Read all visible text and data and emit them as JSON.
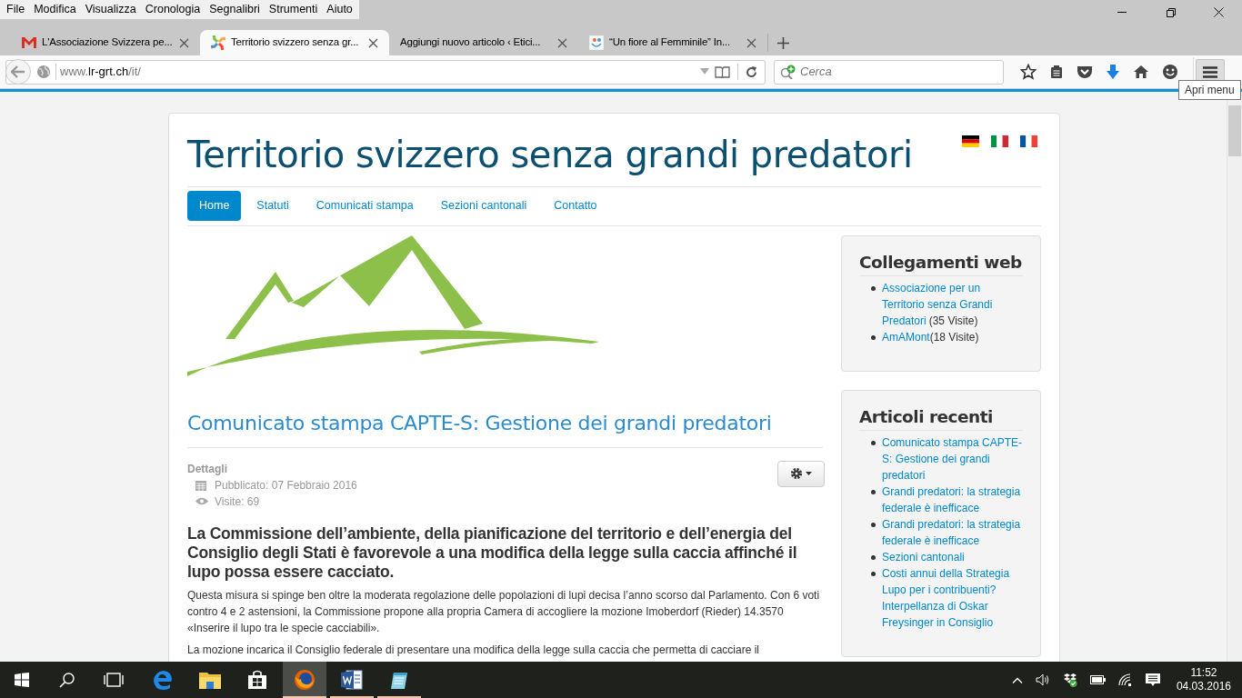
{
  "menu_bar": {
    "items": [
      "File",
      "Modifica",
      "Visualizza",
      "Cronologia",
      "Segnalibri",
      "Strumenti",
      "Aiuto"
    ]
  },
  "tabs": [
    {
      "title": "L'Associazione Svizzera pe...",
      "kind": "letter",
      "selected": false
    },
    {
      "title": "Territorio svizzero senza gr...",
      "kind": "pinwheel",
      "selected": true
    },
    {
      "title": "Aggiungi nuovo articolo ‹ Etici...",
      "kind": "plain",
      "selected": false
    },
    {
      "title": "“Un fiore al Femminile” In...",
      "kind": "tile",
      "selected": false
    }
  ],
  "address_bar": {
    "prefix": "www.",
    "host": "lr-grt.ch",
    "path": "/it/"
  },
  "search": {
    "placeholder": "Cerca"
  },
  "tooltip": "Apri menu",
  "site": {
    "title": "Territorio svizzero senza grandi predatori",
    "nav": [
      {
        "label": "Home",
        "selected": true
      },
      {
        "label": "Statuti",
        "selected": false
      },
      {
        "label": "Comunicati stampa",
        "selected": false
      },
      {
        "label": "Sezioni cantonali",
        "selected": false
      },
      {
        "label": "Contatto",
        "selected": false
      }
    ]
  },
  "article": {
    "title": "Comunicato stampa CAPTE-S: Gestione dei grandi predatori",
    "details_label": "Dettagli",
    "published": "Pubblicato: 07 Febbraio 2016",
    "visits": "Visite: 69",
    "lead": "La Commissione dell’ambiente, della pianificazione del territorio e dell’energia del Consiglio degli Stati è favorevole a una modifica della legge sulla caccia affinché il lupo possa essere cacciato.",
    "paragraphs": [
      "Questa misura si spinge ben oltre la moderata regolazione delle popolazioni di lupi decisa l’anno scorso dal Parlamento. Con 6 voti contro 4 e 2 astensioni, la Commissione propone alla propria Camera di accogliere la mozione Imoberdorf (Rieder) 14.3570 «Inserire il lupo tra le specie cacciabili».",
      "La mozione incarica il Consiglio federale di presentare una modifica della legge sulla caccia che permetta di cacciare il"
    ]
  },
  "sidebar": {
    "panels": [
      {
        "title": "Collegamenti web",
        "items": [
          {
            "link": "Associazione per un Territorio senza Grandi Predatori",
            "count": "(35 Visite)",
            "gap_before": true
          },
          {
            "link": "AmAMont",
            "count": "(18 Visite)",
            "gap_before": false
          }
        ]
      },
      {
        "title": "Articoli recenti",
        "items": [
          {
            "link": "Comunicato stampa CAPTE-S: Gestione dei grandi predatori"
          },
          {
            "link": "Grandi predatori: la strategia federale è inefficace"
          },
          {
            "link": "Grandi predatori: la strategia federale è inefficace"
          },
          {
            "link": "Sezioni cantonali"
          },
          {
            "link": "Costi annui della Strategia Lupo per i contribuenti? Interpellanza di Oskar Freysinger in Consiglio"
          }
        ]
      }
    ]
  },
  "taskbar": {
    "apps": [
      {
        "kind": "edge",
        "running": false,
        "selected": false
      },
      {
        "kind": "folder",
        "running": false,
        "selected": false
      },
      {
        "kind": "store",
        "running": false,
        "selected": false
      },
      {
        "kind": "firefox",
        "running": true,
        "selected": true
      },
      {
        "kind": "word",
        "running": true,
        "selected": false
      },
      {
        "kind": "notepad",
        "running": true,
        "selected": false
      }
    ],
    "time": "11:52",
    "date": "04.03.2016"
  }
}
